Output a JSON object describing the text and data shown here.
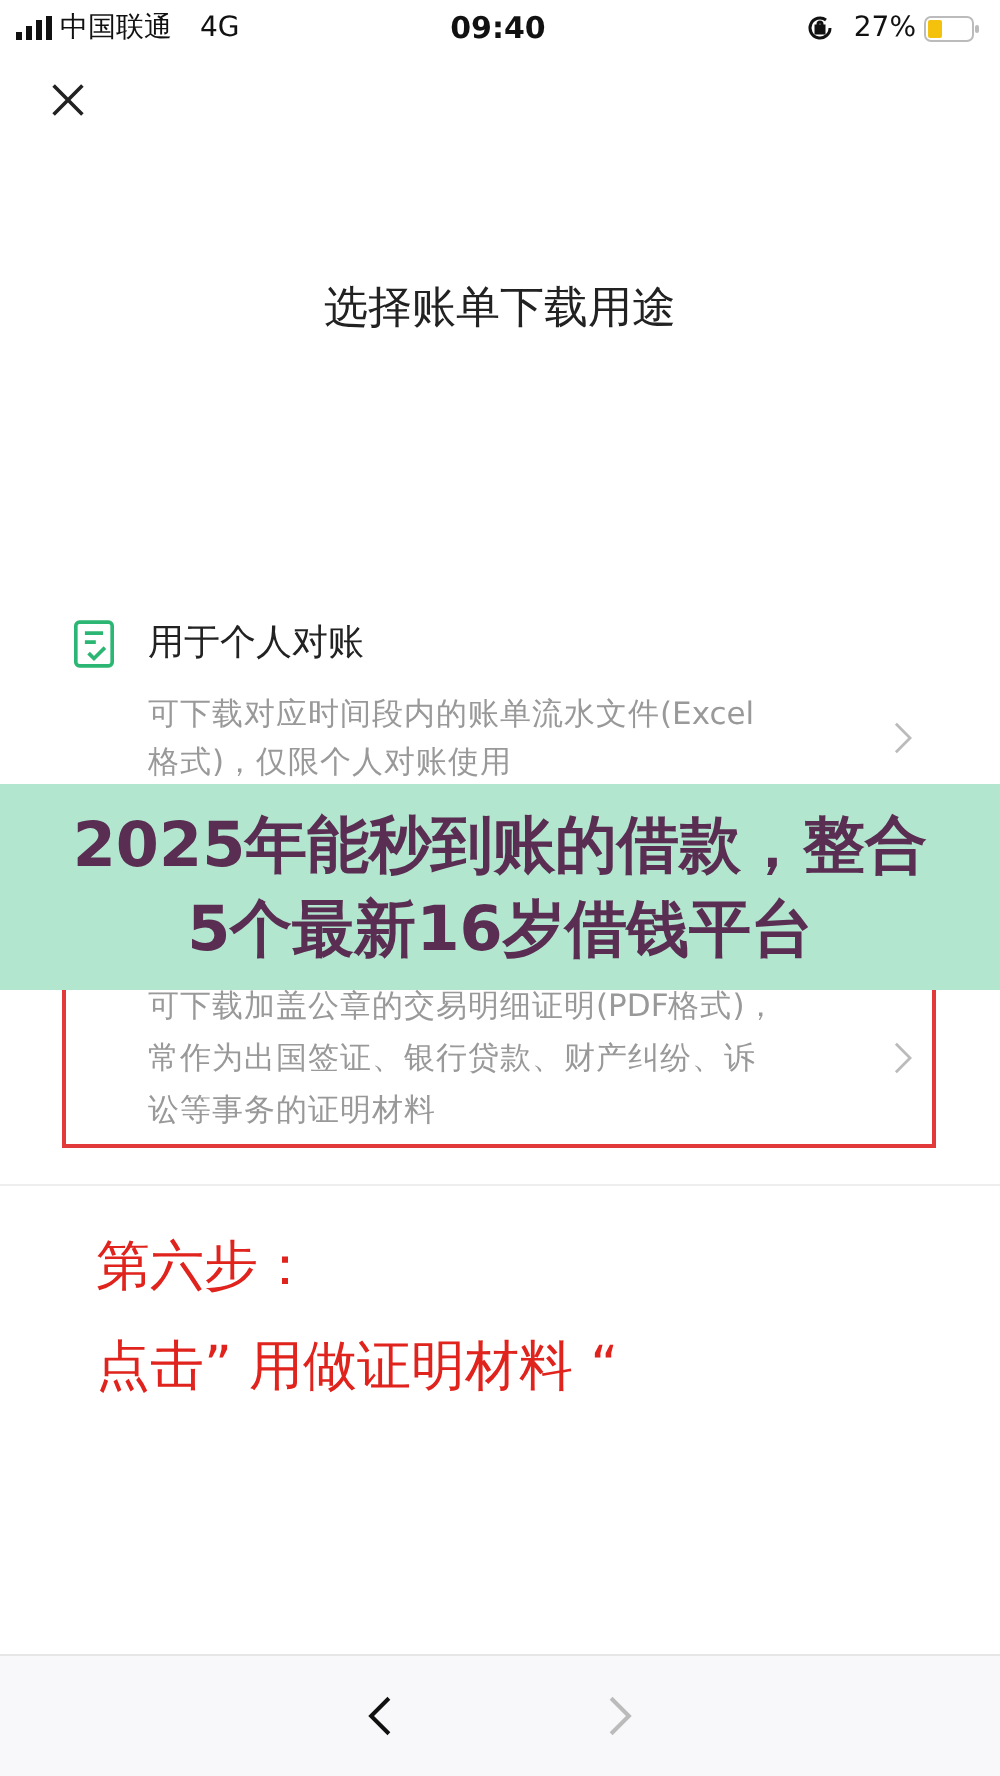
{
  "status_bar": {
    "carrier": "中国联通",
    "network": "4G",
    "time": "09:40",
    "battery": "27%"
  },
  "title": "选择账单下载用途",
  "options": [
    {
      "kind": "checklist",
      "title": "用于个人对账",
      "description": "可下载对应时间段内的账单流水文件(Excel格式)，仅限个人对账使用",
      "highlighted": false
    },
    {
      "description": "可下载加盖公章的交易明细证明(PDF格式)，常作为出国签证、银行贷款、财产纠纷、诉讼等事务的证明材料",
      "highlighted": true
    }
  ],
  "annotation": {
    "lines": [
      "第六步：",
      "点击” 用做证明材料 “"
    ]
  },
  "banner": {
    "text": "2025年能秒到账的借款，整合5个最新16岁借钱平台"
  },
  "nav": [
    {
      "kind": "back",
      "disabled": false
    },
    {
      "kind": "forward",
      "disabled": true
    }
  ]
}
